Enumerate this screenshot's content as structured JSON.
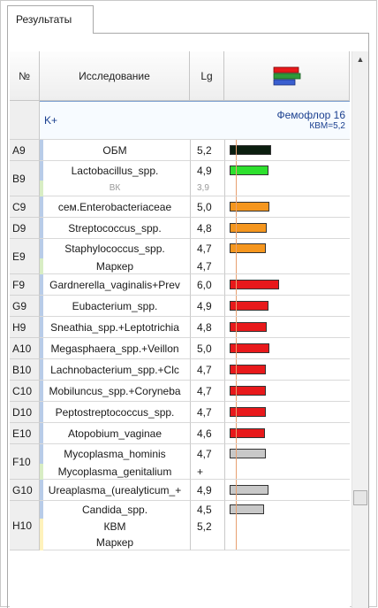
{
  "tab": {
    "label": "Результаты"
  },
  "header": {
    "col_no": "№",
    "col_study": "Исследование",
    "col_lg": "Lg"
  },
  "group": {
    "left": "K+",
    "title": "Фемофлор 16",
    "subtitle": "КВМ=5,2"
  },
  "colors": {
    "black": "#0b1e0f",
    "green": "#2ee02e",
    "orange": "#f5961e",
    "red": "#e8191b",
    "grey": "#c8c8c8",
    "stripe_blue": "#b8cce8",
    "stripe_green": "#d8edc4",
    "stripe_yellow": "#fff2bc",
    "marker_line": "#e8a070"
  },
  "rows": [
    {
      "id": "A9",
      "lines": [
        {
          "name": "ОБМ",
          "lg": "5,2",
          "bar": "black",
          "level": 5.2
        }
      ]
    },
    {
      "id": "B9",
      "lines": [
        {
          "name": "Lactobacillus_spp.",
          "lg": "4,9",
          "bar": "green",
          "level": 4.9
        },
        {
          "name": "ВК",
          "lg": "3,9",
          "muted": true
        }
      ]
    },
    {
      "id": "C9",
      "lines": [
        {
          "name": "сем.Enterobacteriaceae",
          "lg": "5,0",
          "bar": "orange",
          "level": 5.0
        }
      ]
    },
    {
      "id": "D9",
      "lines": [
        {
          "name": "Streptococcus_spp.",
          "lg": "4,8",
          "bar": "orange",
          "level": 4.8
        }
      ]
    },
    {
      "id": "E9",
      "lines": [
        {
          "name": "Staphylococcus_spp.",
          "lg": "4,7",
          "bar": "orange",
          "level": 4.7
        },
        {
          "name": "Маркер",
          "lg": "4,7"
        }
      ]
    },
    {
      "id": "F9",
      "lines": [
        {
          "name": "Gardnerella_vaginalis+Prev",
          "lg": "6,0",
          "bar": "red",
          "level": 6.0
        }
      ]
    },
    {
      "id": "G9",
      "lines": [
        {
          "name": "Eubacterium_spp.",
          "lg": "4,9",
          "bar": "red",
          "level": 4.9
        }
      ]
    },
    {
      "id": "H9",
      "lines": [
        {
          "name": "Sneathia_spp.+Leptotrichia",
          "lg": "4,8",
          "bar": "red",
          "level": 4.8
        }
      ]
    },
    {
      "id": "A10",
      "lines": [
        {
          "name": "Megasphaera_spp.+Veillon",
          "lg": "5,0",
          "bar": "red",
          "level": 5.0
        }
      ]
    },
    {
      "id": "B10",
      "lines": [
        {
          "name": "Lachnobacterium_spp.+Clc",
          "lg": "4,7",
          "bar": "red",
          "level": 4.7
        }
      ]
    },
    {
      "id": "C10",
      "lines": [
        {
          "name": "Mobiluncus_spp.+Coryneba",
          "lg": "4,7",
          "bar": "red",
          "level": 4.7
        }
      ]
    },
    {
      "id": "D10",
      "lines": [
        {
          "name": "Peptostreptococcus_spp.",
          "lg": "4,7",
          "bar": "red",
          "level": 4.7
        }
      ]
    },
    {
      "id": "E10",
      "lines": [
        {
          "name": "Atopobium_vaginae",
          "lg": "4,6",
          "bar": "red",
          "level": 4.6
        }
      ]
    },
    {
      "id": "F10",
      "lines": [
        {
          "name": "Mycoplasma_hominis",
          "lg": "4,7",
          "bar": "grey",
          "level": 4.7
        },
        {
          "name": "Mycoplasma_genitalium",
          "lg": "+"
        }
      ]
    },
    {
      "id": "G10",
      "lines": [
        {
          "name": "Ureaplasma_(urealyticum_+",
          "lg": "4,9",
          "bar": "grey",
          "level": 4.9
        }
      ]
    },
    {
      "id": "H10",
      "lines": [
        {
          "name": "Candida_spp.",
          "lg": "4,5",
          "bar": "grey",
          "level": 4.5
        },
        {
          "name": "КВМ",
          "lg": "5,2"
        },
        {
          "name": "Маркер",
          "lg": ""
        }
      ]
    }
  ]
}
